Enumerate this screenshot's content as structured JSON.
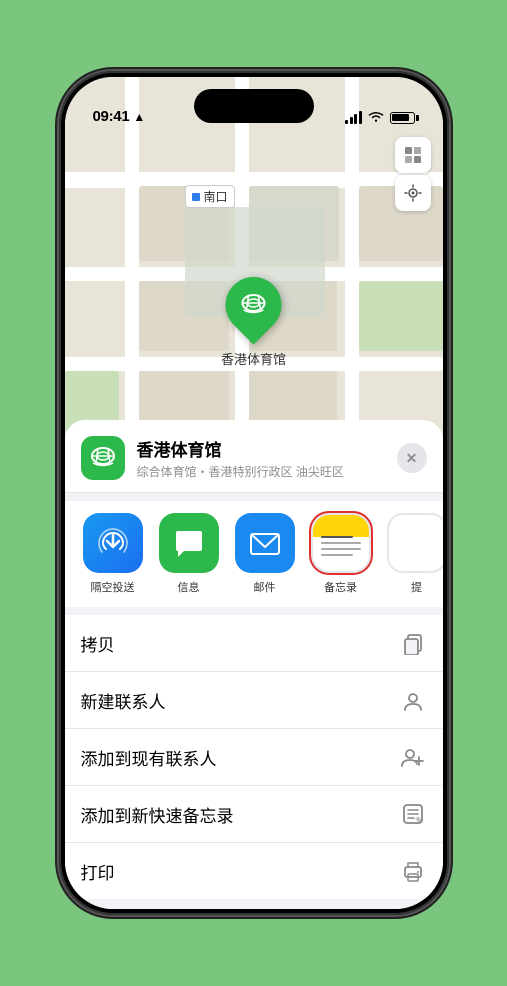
{
  "status_bar": {
    "time": "09:41",
    "location_arrow": "▶"
  },
  "map": {
    "label_text": "南口",
    "controls": {
      "map_type": "🗺",
      "location": "➤"
    }
  },
  "venue": {
    "name": "香港体育馆",
    "subtitle": "综合体育馆・香港特别行政区 油尖旺区",
    "icon_emoji": "🏟",
    "close_label": "✕"
  },
  "share_items": [
    {
      "id": "airdrop",
      "label": "隔空投送",
      "type": "airdrop",
      "selected": false
    },
    {
      "id": "message",
      "label": "信息",
      "type": "message",
      "selected": false
    },
    {
      "id": "mail",
      "label": "邮件",
      "type": "mail",
      "selected": false
    },
    {
      "id": "notes",
      "label": "备忘录",
      "type": "notes",
      "selected": true
    },
    {
      "id": "more",
      "label": "提",
      "type": "more",
      "selected": false
    }
  ],
  "actions": [
    {
      "id": "copy",
      "label": "拷贝",
      "icon": "copy"
    },
    {
      "id": "new-contact",
      "label": "新建联系人",
      "icon": "contact"
    },
    {
      "id": "add-existing",
      "label": "添加到现有联系人",
      "icon": "add-contact"
    },
    {
      "id": "add-notes",
      "label": "添加到新快速备忘录",
      "icon": "notes-quick"
    },
    {
      "id": "print",
      "label": "打印",
      "icon": "printer"
    }
  ]
}
